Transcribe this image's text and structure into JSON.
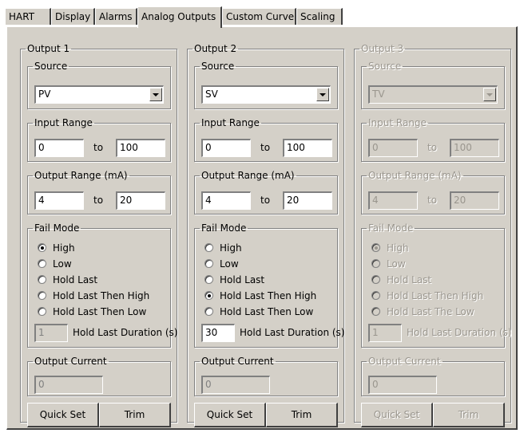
{
  "tabs": [
    "HART",
    "Display",
    "Alarms",
    "Analog Outputs",
    "Custom Curve",
    "Scaling"
  ],
  "active_tab": "Analog Outputs",
  "labels": {
    "source": "Source",
    "input_range": "Input Range",
    "output_range": "Output Range (mA)",
    "to": "to",
    "fail_mode": "Fail Mode",
    "output_current": "Output Current",
    "quick_set": "Quick Set",
    "trim": "Trim"
  },
  "outputs": [
    {
      "title": "Output 1",
      "enabled": true,
      "source": "PV",
      "input_min": "0",
      "input_max": "100",
      "output_min": "4",
      "output_max": "20",
      "fail_modes": [
        "High",
        "Low",
        "Hold Last",
        "Hold Last Then High",
        "Hold Last Then Low"
      ],
      "fail_selected": "High",
      "hold_duration": "1",
      "hold_duration_label": "Hold Last Duration (s)",
      "output_current": "0"
    },
    {
      "title": "Output 2",
      "enabled": true,
      "source": "SV",
      "input_min": "0",
      "input_max": "100",
      "output_min": "4",
      "output_max": "20",
      "fail_modes": [
        "High",
        "Low",
        "Hold Last",
        "Hold Last Then High",
        "Hold Last Then Low"
      ],
      "fail_selected": "Hold Last Then High",
      "hold_duration": "30",
      "hold_duration_label": "Hold Last Duration (s)",
      "output_current": "0"
    },
    {
      "title": "Output 3",
      "enabled": false,
      "source": "TV",
      "input_min": "0",
      "input_max": "100",
      "output_min": "4",
      "output_max": "20",
      "fail_modes": [
        "High",
        "Low",
        "Hold Last",
        "Hold Last Then High",
        "Hold Last The Low"
      ],
      "fail_selected": "High",
      "hold_duration": "1",
      "hold_duration_label": "Hold Last Duration (s)",
      "output_current": "0"
    }
  ],
  "colors": {
    "face": "#d4d0c8",
    "shadow": "#808080",
    "dark_shadow": "#404040",
    "highlight": "#ffffff",
    "disabled_text": "#9a968e"
  }
}
